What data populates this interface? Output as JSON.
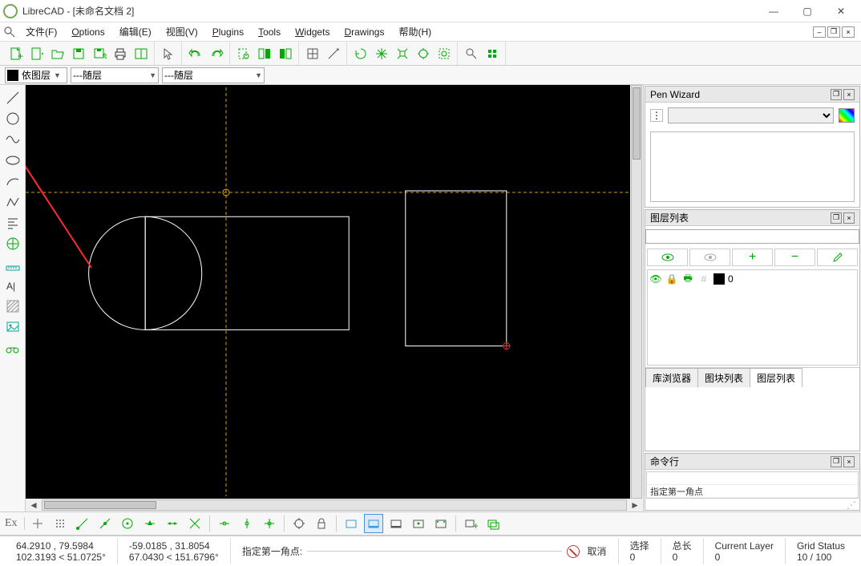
{
  "title": "LibreCAD - [未命名文档 2]",
  "menus": {
    "file": "文件(F)",
    "options": "Options",
    "edit": "编辑(E)",
    "view": "视图(V)",
    "plugins": "Plugins",
    "tools": "Tools",
    "widgets": "Widgets",
    "drawings": "Drawings",
    "help": "帮助(H)"
  },
  "layer_combo": {
    "layer": "依图层",
    "by1": "---随层",
    "by2": "---随层"
  },
  "panels": {
    "pen_wizard": {
      "title": "Pen Wizard"
    },
    "layer_list": {
      "title": "图层列表",
      "layer0": "0"
    },
    "tabs": {
      "lib": "库浏览器",
      "blocks": "图块列表",
      "layers": "图层列表"
    },
    "cmd": {
      "title": "命令行",
      "current": "指定第一角点"
    }
  },
  "status": {
    "abs_x": "64.2910 , 79.5984",
    "abs_ang": "102.3193 < 51.0725°",
    "rel_x": "-59.0185 , 31.8054",
    "rel_ang": "67.0430 < 151.6796°",
    "prompt": "指定第一角点:",
    "cancel": "取消",
    "sel_label": "选择",
    "sel_val": "0",
    "len_label": "总长",
    "len_val": "0",
    "curlayer_label": "Current Layer",
    "curlayer_val": "0",
    "grid_label": "Grid Status",
    "grid_val": "10 / 100"
  }
}
